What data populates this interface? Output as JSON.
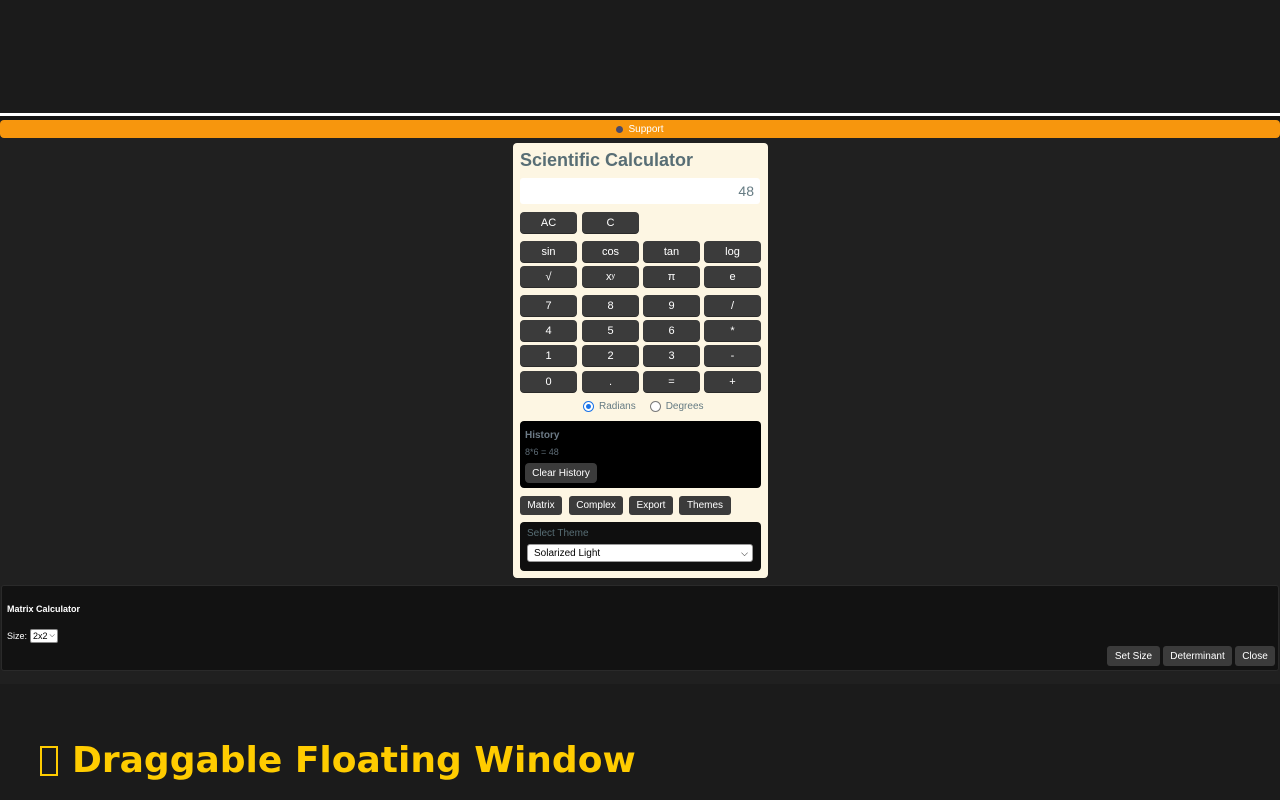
{
  "support": {
    "label": "Support",
    "icon": "globe-icon"
  },
  "calculator": {
    "title": "Scientific Calculator",
    "display": "48",
    "clear_buttons": [
      "AC",
      "C"
    ],
    "function_buttons": [
      "sin",
      "cos",
      "tan",
      "log"
    ],
    "special_buttons": [
      "√",
      "x",
      "π",
      "e"
    ],
    "power_superscript": "y",
    "digit_rows": [
      [
        "7",
        "8",
        "9",
        "/"
      ],
      [
        "4",
        "5",
        "6",
        "*"
      ],
      [
        "1",
        "2",
        "3",
        "-"
      ],
      [
        "0",
        ".",
        "=",
        "+"
      ]
    ],
    "angle_modes": [
      {
        "label": "Radians",
        "selected": true
      },
      {
        "label": "Degrees",
        "selected": false
      }
    ],
    "history": {
      "title": "History",
      "entries": [
        "8*6 = 48"
      ],
      "clear_label": "Clear History"
    },
    "tools": [
      "Matrix",
      "Complex",
      "Export",
      "Themes"
    ],
    "theme": {
      "label": "Select Theme",
      "selected": "Solarized Light"
    }
  },
  "matrix": {
    "title": "Matrix Calculator",
    "size_label": "Size:",
    "size_value": "2x2",
    "buttons": [
      "Set Size",
      "Determinant",
      "Close"
    ]
  },
  "page": {
    "heading": "Draggable Floating Window"
  },
  "colors": {
    "support_bar": "#f7960d",
    "calc_background": "#fdf6e3",
    "button": "#3b3b3b",
    "heading": "#ffcc00"
  }
}
